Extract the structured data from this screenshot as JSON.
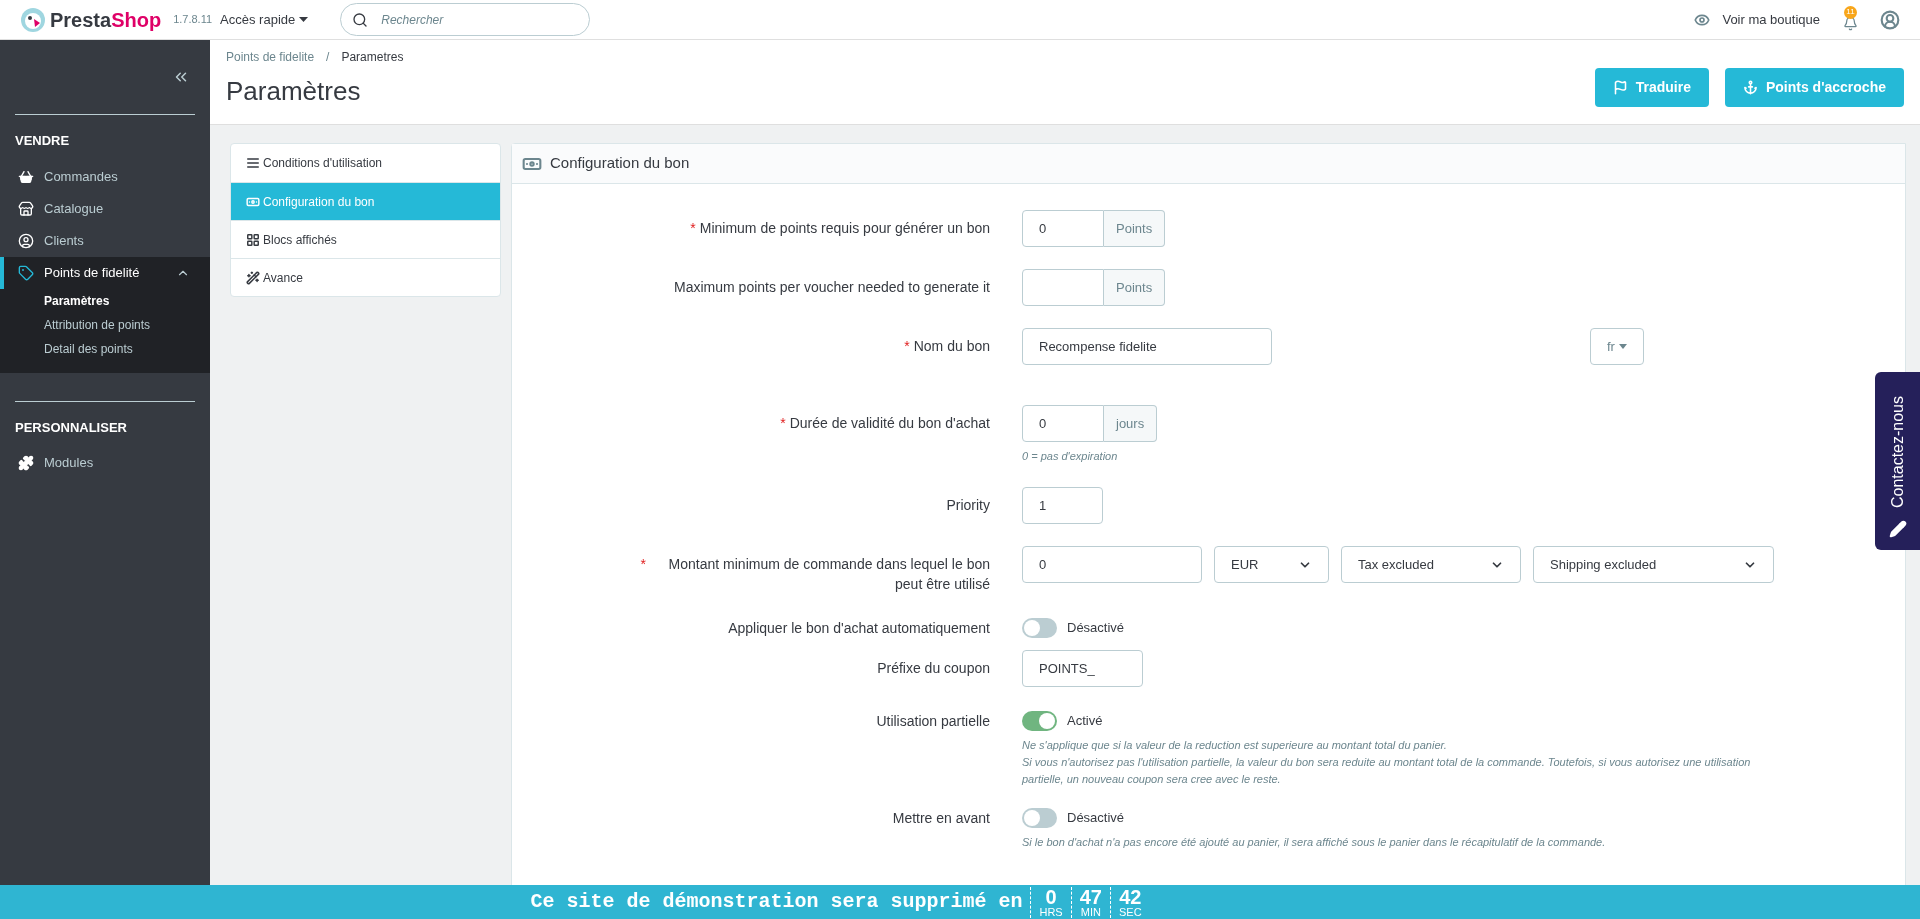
{
  "topbar": {
    "logo_parts": [
      "Presta",
      "Shop"
    ],
    "version": "1.7.8.11",
    "quick_access": "Accès rapide",
    "search": {
      "placeholder": "Rechercher"
    },
    "view_shop": "Voir ma boutique",
    "notifications": "11"
  },
  "sidebar": {
    "sections": [
      {
        "title": "VENDRE",
        "items": [
          {
            "label": "Commandes",
            "selected": false
          },
          {
            "label": "Catalogue",
            "selected": false
          },
          {
            "label": "Clients",
            "selected": false
          },
          {
            "label": "Points de fidelité",
            "selected": true,
            "expanded": true,
            "children": [
              {
                "label": "Paramètres",
                "selected": true
              },
              {
                "label": "Attribution de points",
                "selected": false
              },
              {
                "label": "Detail des points",
                "selected": false
              }
            ]
          }
        ]
      },
      {
        "title": "PERSONNALISER",
        "items": [
          {
            "label": "Modules",
            "selected": false
          }
        ]
      }
    ]
  },
  "header": {
    "breadcrumb": [
      "Points de fidelite",
      "Parametres"
    ],
    "breadcrumb_separator": "/",
    "title": "Paramètres",
    "buttons": [
      {
        "label": "Traduire"
      },
      {
        "label": "Points d'accroche"
      }
    ]
  },
  "tabs": [
    {
      "label": "Conditions d'utilisation",
      "selected": false
    },
    {
      "label": "Configuration du bon",
      "selected": true
    },
    {
      "label": "Blocs affichés",
      "selected": false
    },
    {
      "label": "Avance",
      "selected": false
    }
  ],
  "panel": {
    "title": "Configuration du bon",
    "fields": [
      {
        "kind": "addon",
        "label": "Minimum de points requis pour générer un bon",
        "required_mark": "*",
        "value": "0",
        "addon": "Points"
      },
      {
        "kind": "addon",
        "label": "Maximum points per voucher needed to generate it",
        "addon": "Points"
      },
      {
        "kind": "lang",
        "label": "Nom du bon",
        "required_mark": "*",
        "value": "Recompense fidelite",
        "language": "fr"
      },
      {
        "kind": "addon",
        "label": "Durée de validité du bon d'achat",
        "required_mark": "*",
        "value": "0",
        "addon": "jours",
        "help": [
          "0 = pas d'expiration"
        ]
      },
      {
        "kind": "small",
        "label": "Priority",
        "value": "1"
      },
      {
        "kind": "amount",
        "label": "Montant minimum de commande dans lequel le bon peut être utilisé",
        "required_mark": "*",
        "value": "0",
        "selects": [
          "EUR",
          "Tax excluded",
          "Shipping excluded"
        ]
      },
      {
        "kind": "switch",
        "label": "Appliquer le bon d'achat automatiquement",
        "on": false,
        "state": "Désactivé"
      },
      {
        "kind": "text",
        "label": "Préfixe du coupon",
        "value": "POINTS_"
      },
      {
        "kind": "switch",
        "label": "Utilisation partielle",
        "on": true,
        "state": "Activé",
        "help": [
          "Ne s'applique que si la valeur de la reduction est superieure au montant total du panier.",
          "Si vous n'autorisez pas l'utilisation partielle, la valeur du bon sera reduite au montant total de la commande. Toutefois, si vous autorisez une utilisation partielle, un nouveau coupon sera cree avec le reste."
        ]
      },
      {
        "kind": "switch",
        "label": "Mettre en avant",
        "on": false,
        "state": "Désactivé",
        "help": [
          "Si le bon d'achat n'a pas encore été ajouté au panier, il sera affiché sous le panier dans le récapitulatif de la commande."
        ]
      }
    ]
  },
  "contact_tab": "Contactez-nous",
  "demo_banner": {
    "message": "Ce site de démonstration sera supprimé en",
    "countdown": [
      {
        "value": "0",
        "unit": "HRS"
      },
      {
        "value": "47",
        "unit": "MIN"
      },
      {
        "value": "42",
        "unit": "SEC"
      }
    ]
  }
}
